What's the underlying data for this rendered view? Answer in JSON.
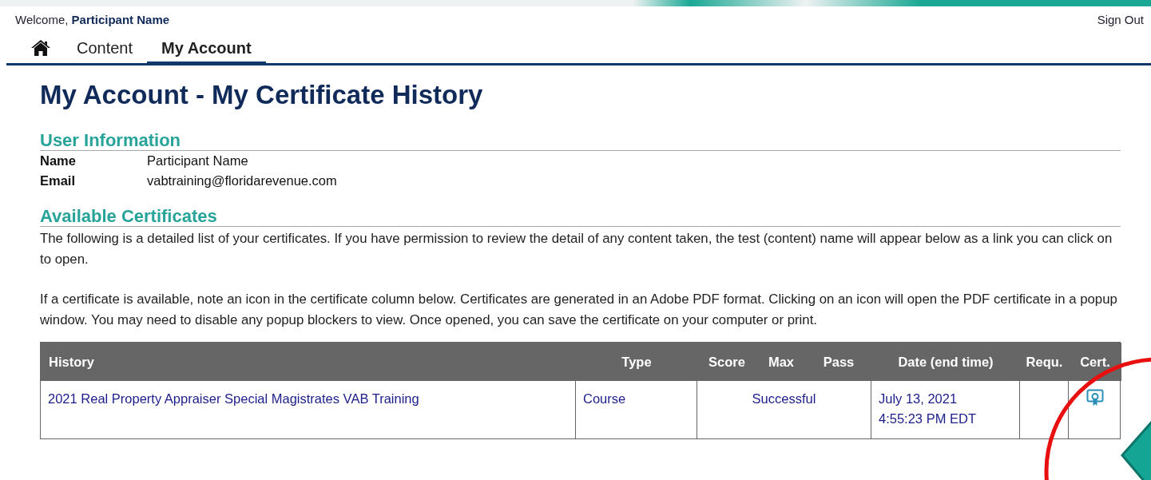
{
  "header": {
    "welcome": "Welcome,",
    "user": "Participant Name",
    "sign_out": "Sign Out"
  },
  "tabs": [
    {
      "kind": "home",
      "selected": false
    },
    {
      "kind": "text",
      "label": "Content",
      "selected": false
    },
    {
      "kind": "text",
      "label": "My Account",
      "selected": true
    }
  ],
  "page_title": "My Account - My Certificate History",
  "user_info": {
    "heading": "User Information",
    "fields": [
      {
        "label": "Name",
        "value": "Participant Name"
      },
      {
        "label": "Email",
        "value": "vabtraining@floridarevenue.com"
      }
    ]
  },
  "certificates": {
    "heading": "Available Certificates",
    "paragraphs": [
      "The following is a detailed list of your certificates. If you have permission to review the detail of any content taken, the test (content) name will appear below as a link you can click on to open.",
      "If a certificate is available, note an icon in the certificate column below. Certificates are generated in an Adobe PDF format. Clicking on an icon will open the PDF certificate in a popup window. You may need to disable any popup blockers to view. Once opened, you can save the certificate on your computer or print."
    ]
  },
  "table": {
    "columns": [
      "History",
      "Type",
      "Score",
      "Max",
      "Pass",
      "Date (end time)",
      "Requ.",
      "Cert."
    ],
    "rows": [
      {
        "history": "2021 Real Property Appraiser Special Magistrates VAB Training",
        "type": "Course",
        "result": "Successful",
        "date": "July 13, 2021",
        "time": "4:55:23 PM EDT",
        "certificate": true
      }
    ]
  }
}
